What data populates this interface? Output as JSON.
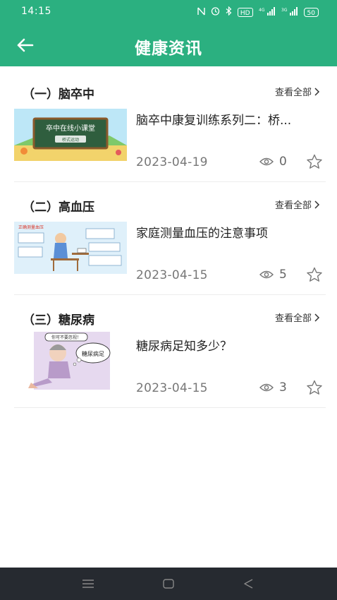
{
  "status_bar": {
    "time": "14:15",
    "hd": "HD",
    "net1": "4G",
    "net2": "3G",
    "battery": "50"
  },
  "header": {
    "title": "健康资讯"
  },
  "sections": [
    {
      "title": "（一）脑卒中",
      "more_label": "查看全部",
      "article": {
        "title": "脑卒中康复训练系列二：桥...",
        "date": "2023-04-19",
        "views": "0",
        "thumb_text_1": "卒中在线小课堂",
        "thumb_text_2": "桥式运动"
      }
    },
    {
      "title": "（二）高血压",
      "more_label": "查看全部",
      "article": {
        "title": "家庭测量血压的注意事项",
        "date": "2023-04-15",
        "views": "5",
        "thumb_text_1": "正确测量血压"
      }
    },
    {
      "title": "（三）糖尿病",
      "more_label": "查看全部",
      "article": {
        "title": "糖尿病足知多少？",
        "date": "2023-04-15",
        "views": "3",
        "thumb_text_1": "你可不要忽视！",
        "thumb_text_2": "糖尿病足"
      }
    }
  ],
  "colors": {
    "primary": "#2bb080",
    "nav_bar": "#262a30"
  },
  "icons": [
    "back-arrow-icon",
    "eye-icon",
    "star-icon",
    "chevron-right-icon",
    "menu-icon",
    "home-icon",
    "back-triangle-icon"
  ]
}
